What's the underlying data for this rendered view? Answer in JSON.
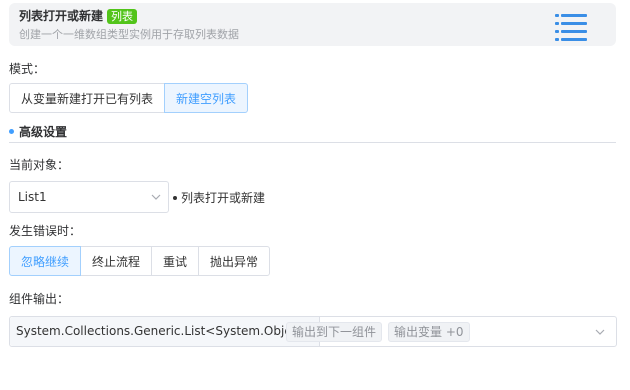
{
  "header": {
    "title": "列表打开或新建",
    "badge": "列表",
    "description": "创建一个一维数组类型实例用于存取列表数据",
    "icon": "list-icon",
    "accent_color": "#3a8ee6"
  },
  "mode": {
    "label": "模式：",
    "options": [
      "从变量新建打开已有列表",
      "新建空列表"
    ],
    "selected_index": 1
  },
  "advanced": {
    "title": "高级设置"
  },
  "current_object": {
    "label": "当前对象：",
    "value": "List1",
    "note": "列表打开或新建"
  },
  "on_error": {
    "label": "发生错误时：",
    "options": [
      "忽略继续",
      "终止流程",
      "重试",
      "抛出异常"
    ],
    "selected_index": 0
  },
  "output": {
    "label": "组件输出：",
    "type": "System.Collections.Generic.List<System.Object>",
    "tags": [
      "输出到下一组件",
      "输出变量 +0"
    ]
  },
  "colors": {
    "active": "#409eff",
    "badge": "#52c41a",
    "border": "#dcdfe6"
  }
}
